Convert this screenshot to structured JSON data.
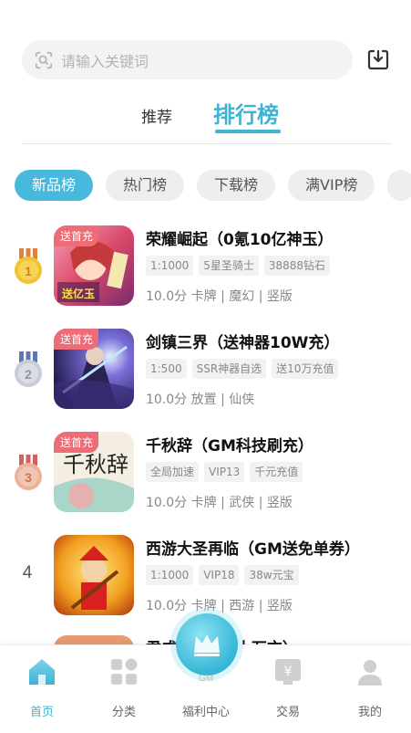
{
  "search": {
    "placeholder": "请输入关键词"
  },
  "top_tabs": [
    {
      "label": "推荐"
    },
    {
      "label": "排行榜"
    }
  ],
  "categories": [
    {
      "label": "新品榜",
      "active": true
    },
    {
      "label": "热门榜"
    },
    {
      "label": "下载榜"
    },
    {
      "label": "满VIP榜"
    }
  ],
  "games": [
    {
      "rank": "1",
      "promo": "送首充",
      "title": "荣耀崛起（0氪10亿神玉）",
      "tags": [
        "1:1000",
        "5星圣骑士",
        "38888钻石"
      ],
      "meta": "10.0分 卡牌 | 魔幻 | 竖版",
      "thumb_text": "送亿玉"
    },
    {
      "rank": "2",
      "promo": "送首充",
      "title": "剑镇三界（送神器10W充）",
      "tags": [
        "1:500",
        "SSR神器自选",
        "送10万充值"
      ],
      "meta": "10.0分 放置 | 仙侠"
    },
    {
      "rank": "3",
      "promo": "送首充",
      "title": "千秋辞（GM科技刷充）",
      "tags": [
        "全局加速",
        "VIP13",
        "千元充值"
      ],
      "meta": "10.0分 卡牌 | 武侠 | 竖版",
      "thumb_text": "千秋辞"
    },
    {
      "rank": "4",
      "promo": "",
      "title": "西游大圣再临（GM送免单券）",
      "tags": [
        "1:1000",
        "VIP18",
        "38w元宝"
      ],
      "meta": "10.0分 卡牌 | 西游 | 竖版"
    }
  ],
  "partial": {
    "title": "君成…送GM十万充）"
  },
  "bottom_nav": [
    {
      "label": "首页",
      "active": true,
      "icon": "home-icon"
    },
    {
      "label": "分类",
      "icon": "category-icon"
    },
    {
      "label": "福利中心",
      "icon": "crown-icon"
    },
    {
      "label": "交易",
      "icon": "trade-icon"
    },
    {
      "label": "我的",
      "icon": "user-icon"
    }
  ],
  "center_badge": "GM",
  "colors": {
    "accent": "#3fb3d3",
    "promo": "#ee6c76"
  }
}
